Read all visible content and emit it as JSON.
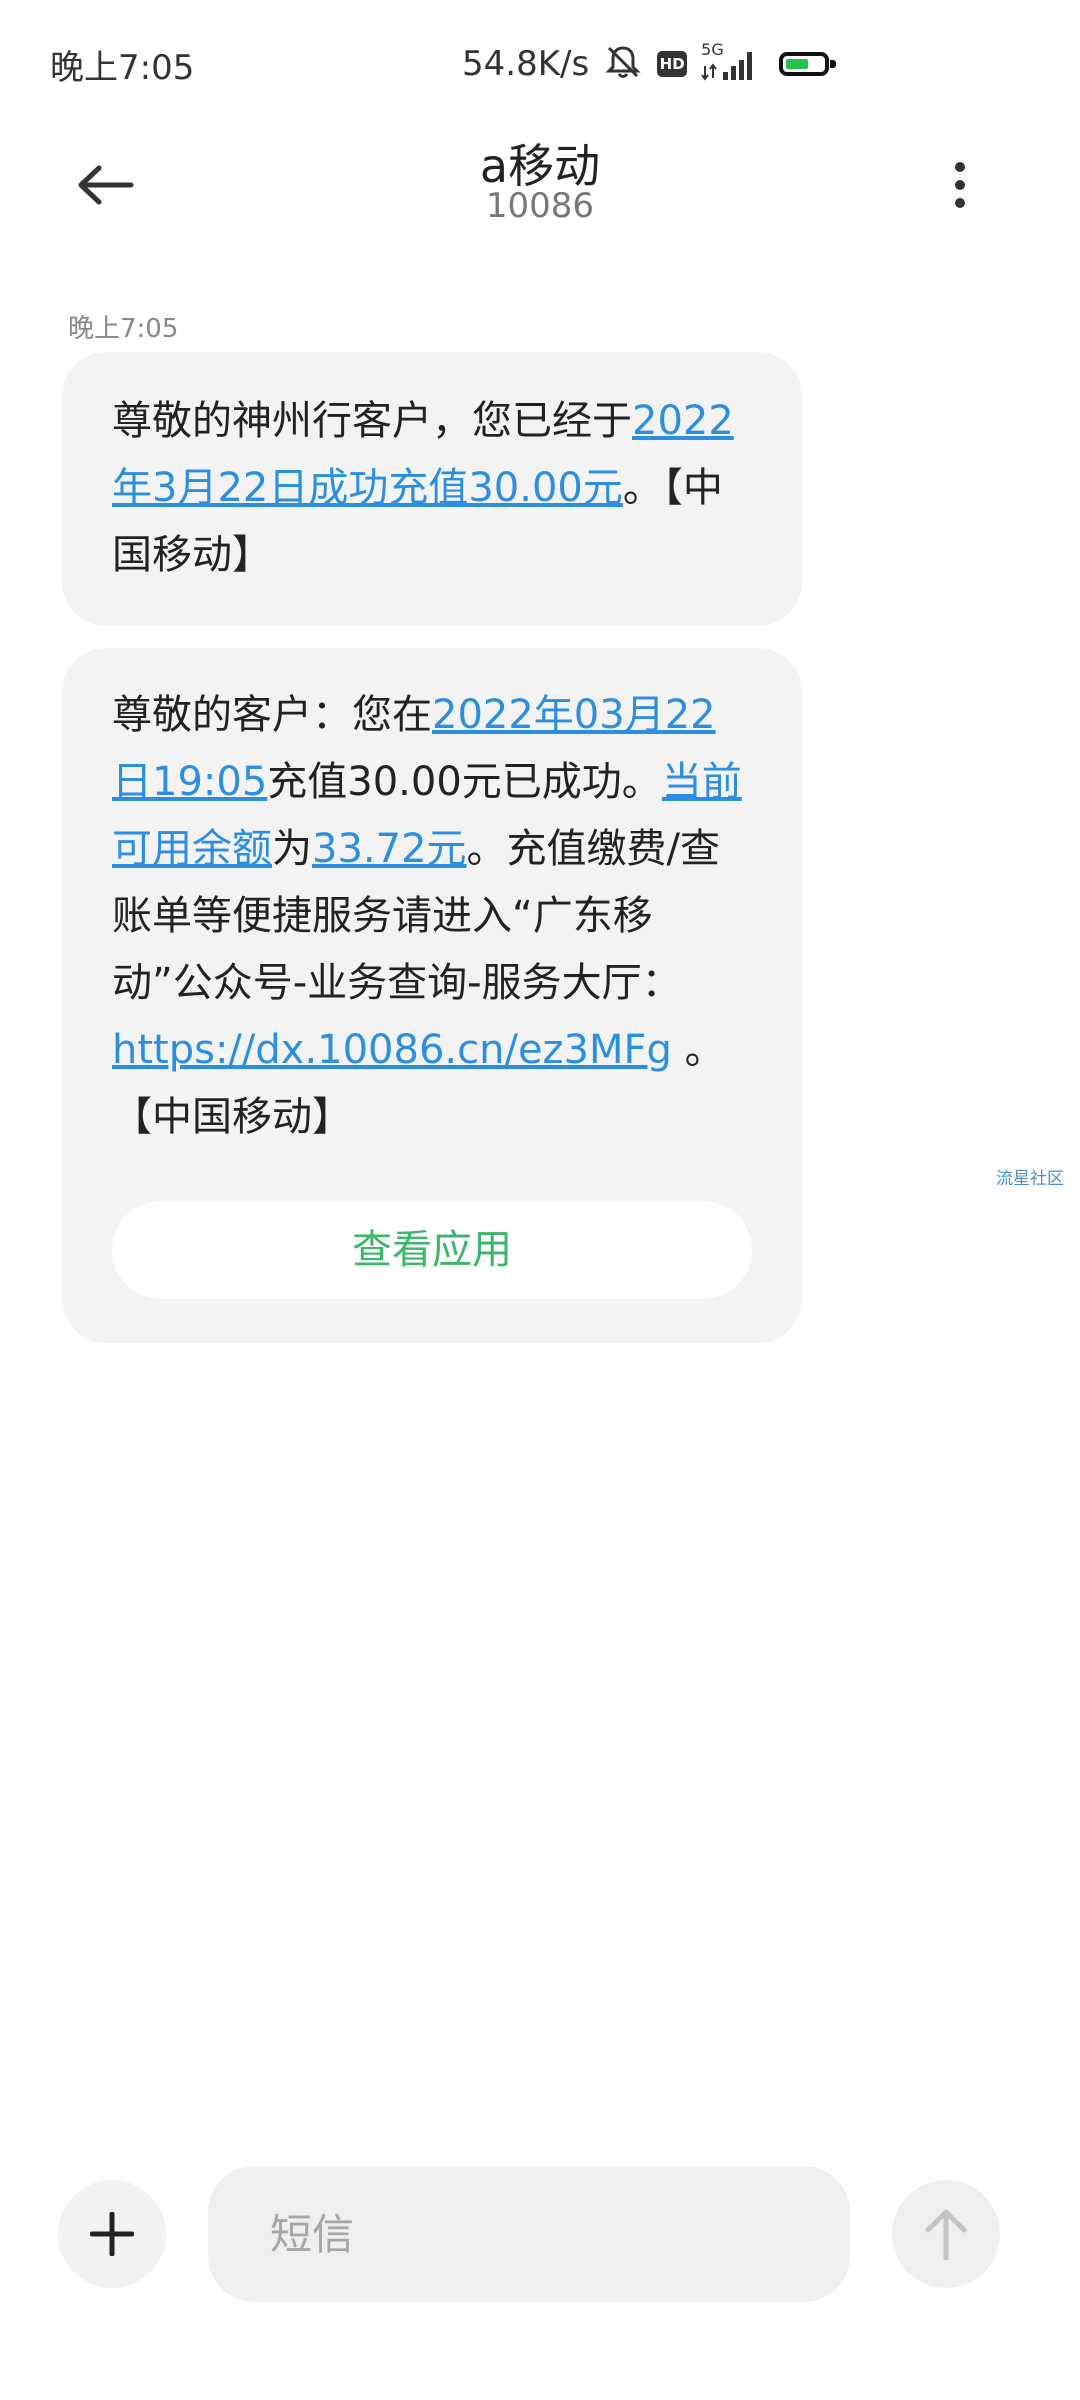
{
  "status_bar": {
    "time": "晚上7:05",
    "net_speed": "54.8K/s",
    "hd_label": "HD",
    "network_type": "5G",
    "icons": [
      "mute-bell-icon",
      "hd-icon",
      "signal-5g-icon",
      "battery-icon"
    ],
    "battery_level": 0.6,
    "battery_color": "#27c24c"
  },
  "header": {
    "title": "a移动",
    "subtitle": "10086",
    "icons": [
      "back-arrow-icon",
      "more-vert-icon"
    ]
  },
  "conversation": {
    "timestamp": "晚上7:05",
    "messages": [
      {
        "segments": [
          {
            "text": "尊敬的神州行客户，您已经于",
            "link": false
          },
          {
            "text": "2022年3月22日成功充值30.00元",
            "link": true
          },
          {
            "text": "。【中国移动】",
            "link": false
          }
        ]
      },
      {
        "segments": [
          {
            "text": "尊敬的客户：您在",
            "link": false
          },
          {
            "text": "2022年03月22日19:05",
            "link": true
          },
          {
            "text": "充值30.00元已成功。",
            "link": false
          },
          {
            "text": "当前可用余额",
            "link": true
          },
          {
            "text": "为",
            "link": false
          },
          {
            "text": "33.72元",
            "link": true
          },
          {
            "text": "。充值缴费/查账单等便捷服务请进入“广东移动”公众号-业务查询-服务大厅：",
            "link": false
          },
          {
            "text": "https://dx.10086.cn/ez3MFg",
            "link": true
          },
          {
            "text": " 。【中国移动】",
            "link": false
          }
        ],
        "action_label": "查看应用"
      }
    ]
  },
  "watermark": "流星社区",
  "input_bar": {
    "placeholder": "短信",
    "icons": [
      "plus-icon",
      "send-arrow-icon"
    ]
  },
  "colors": {
    "link": "#2c8ee0",
    "action": "#3bb66b",
    "bubble": "#f3f3f3"
  }
}
